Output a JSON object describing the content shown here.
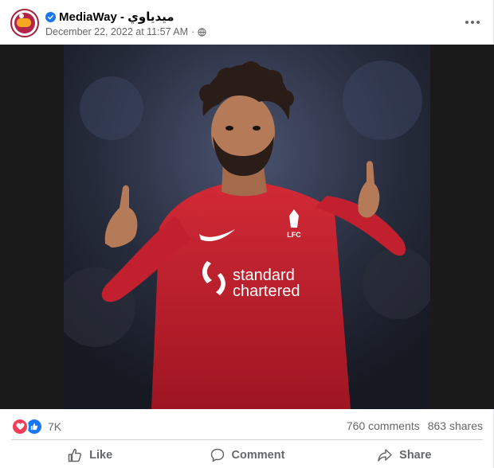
{
  "post": {
    "page_name": "MediaWay - ميدياوي",
    "verified": true,
    "timestamp": "December 22, 2022 at 11:57 AM",
    "separator": "·",
    "privacy_icon": "globe-icon",
    "more_icon": "more-dots-icon"
  },
  "photo": {
    "sponsor_line1": "standard",
    "sponsor_line2": "chartered",
    "crest_text": "LFC"
  },
  "stats": {
    "reaction_types": [
      "love",
      "like"
    ],
    "reaction_count": "7K",
    "comments": "760 comments",
    "shares": "863 shares"
  },
  "actions": {
    "like_label": "Like",
    "comment_label": "Comment",
    "share_label": "Share"
  },
  "colors": {
    "facebook_blue": "#1877f2",
    "love_red": "#f33e58",
    "jersey_red": "#c8202f",
    "muted_text": "#65676b"
  }
}
